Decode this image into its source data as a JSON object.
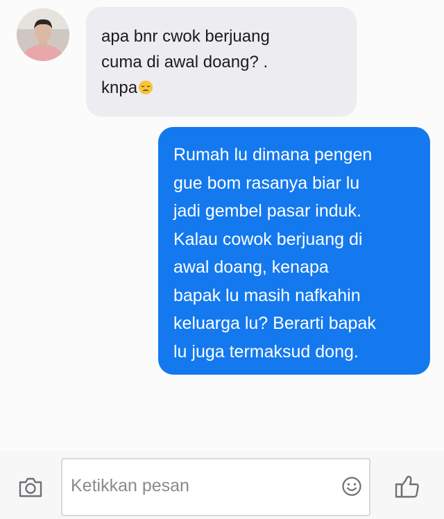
{
  "received_message": {
    "lines": [
      "apa bnr cwok berjuang",
      "cuma di awal doang? .",
      "knpa"
    ],
    "emoji": "disappointed-face-emoji"
  },
  "sent_message": {
    "lines": [
      "Rumah lu dimana pengen",
      "gue bom rasanya biar lu",
      "jadi gembel pasar induk.",
      "Kalau cowok berjuang di",
      "awal doang, kenapa",
      "bapak lu masih nafkahin",
      "keluarga lu? Berarti bapak",
      "lu juga termaksud dong."
    ]
  },
  "composer": {
    "placeholder": "Ketikkan pesan",
    "camera_icon": "camera-icon",
    "emoji_icon": "smiley-icon",
    "like_icon": "thumbs-up-icon"
  },
  "colors": {
    "incoming_bubble": "#ececf1",
    "outgoing_bubble": "#1479ee",
    "icon": "#6f6f74"
  }
}
